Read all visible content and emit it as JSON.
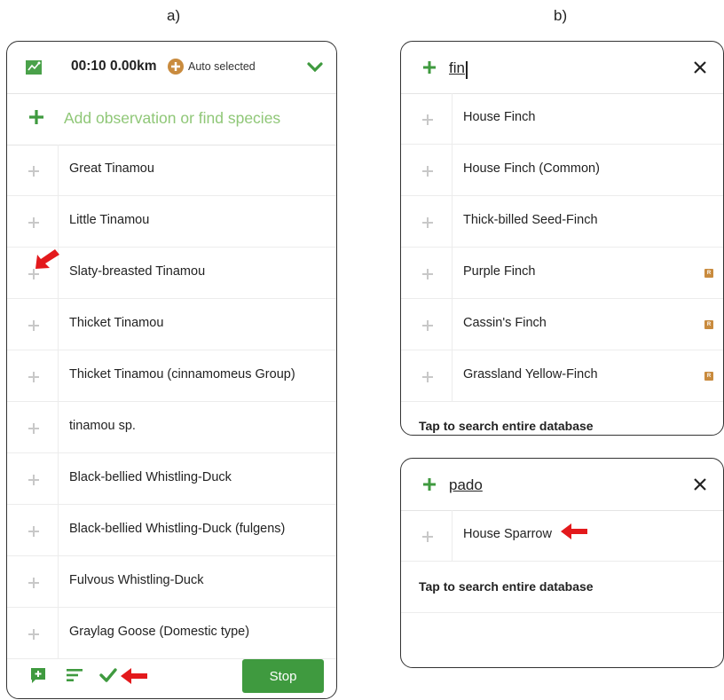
{
  "labels": {
    "a": "a)",
    "b": "b)"
  },
  "panel_a": {
    "header": {
      "time_distance": "00:10 0.00km",
      "location_status": "Auto selected",
      "map_icon": "map-icon",
      "location_icon": "location-pin-icon",
      "collapse_icon": "chevron-down-icon"
    },
    "add_observation": {
      "placeholder": "Add observation or find species"
    },
    "species": [
      "Great Tinamou",
      "Little Tinamou",
      "Slaty-breasted Tinamou",
      "Thicket Tinamou",
      "Thicket Tinamou (cinnamomeus Group)",
      "tinamou sp.",
      "Black-bellied Whistling-Duck",
      "Black-bellied Whistling-Duck (fulgens)",
      "Fulvous Whistling-Duck",
      "Graylag Goose (Domestic type)"
    ],
    "footer": {
      "stop_label": "Stop",
      "icons": [
        "add-comment-icon",
        "sort-icon",
        "checkmark-icon"
      ]
    }
  },
  "panel_b1": {
    "query": "fin",
    "results": [
      {
        "name": "House Finch",
        "badge": ""
      },
      {
        "name": "House Finch (Common)",
        "badge": ""
      },
      {
        "name": "Thick-billed Seed-Finch",
        "badge": ""
      },
      {
        "name": "Purple Finch",
        "badge": "R"
      },
      {
        "name": "Cassin's Finch",
        "badge": "R"
      },
      {
        "name": "Grassland Yellow-Finch",
        "badge": "R"
      }
    ],
    "search_all": "Tap to search entire database"
  },
  "panel_b2": {
    "query": "pado",
    "results": [
      {
        "name": "House Sparrow",
        "badge": ""
      }
    ],
    "search_all": "Tap to search entire database"
  },
  "colors": {
    "accent_green": "#3f9a3f",
    "placeholder_green": "#8fc777",
    "arrow_red": "#e3191c",
    "rare_badge": "#c98b3e"
  }
}
